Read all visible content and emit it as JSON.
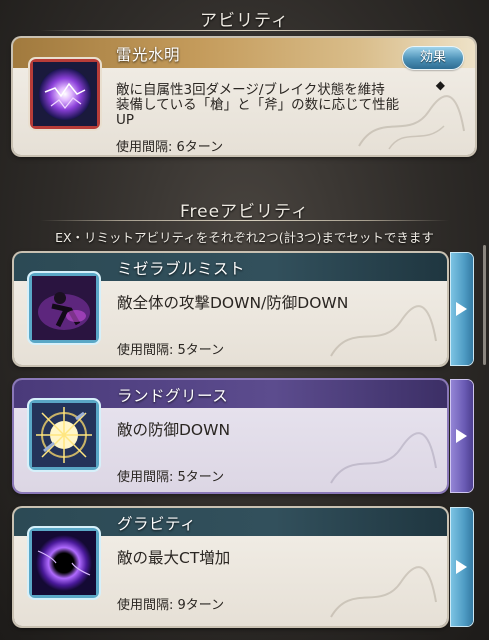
{
  "ability_section": {
    "title": "アビリティ"
  },
  "main_ability": {
    "name": "雷光水明",
    "effect_button": "効果",
    "description_line1": "敵に自属性3回ダメージ/ブレイク状態を維持",
    "description_line2": "装備している「槍」と「斧」の数に応じて性能",
    "description_line3": "UP",
    "marker": "◆",
    "cooldown": "使用間隔: 6ターン",
    "icon": "purple-lightning-orb-icon"
  },
  "free_section": {
    "title": "Freeアビリティ",
    "note": "EX・リミットアビリティをそれぞれ2つ(計3つ)までセットできます"
  },
  "free_abilities": [
    {
      "name": "ミゼラブルミスト",
      "description": "敵全体の攻撃DOWN/防御DOWN",
      "cooldown": "使用間隔: 5ターン",
      "icon": "misty-figure-icon"
    },
    {
      "name": "ランドグリース",
      "description": "敵の防御DOWN",
      "cooldown": "使用間隔: 5ターン",
      "icon": "shattered-shield-icon"
    },
    {
      "name": "グラビティ",
      "description": "敵の最大CT増加",
      "cooldown": "使用間隔: 9ターン",
      "icon": "black-hole-icon"
    }
  ],
  "colors": {
    "main_header": "#c49b5b",
    "free_header": "#32505c",
    "selected_header": "#5c4c8e",
    "tab_blue": "#4f9cc4",
    "tab_purple": "#6b5cb5"
  }
}
